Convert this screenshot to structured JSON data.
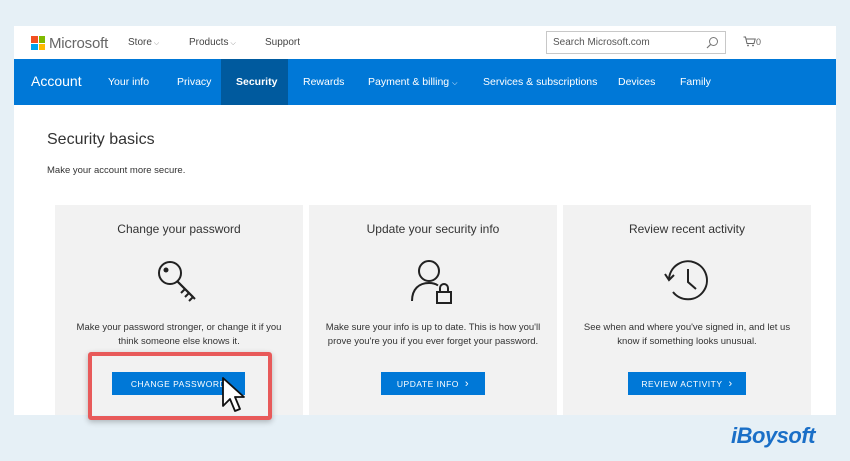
{
  "topbar": {
    "brand": "Microsoft",
    "links": [
      {
        "label": "Store",
        "has_dropdown": true
      },
      {
        "label": "Products",
        "has_dropdown": true
      },
      {
        "label": "Support",
        "has_dropdown": false
      }
    ],
    "search_placeholder": "Search Microsoft.com",
    "cart_count": "0",
    "logo_colors": [
      "#f25022",
      "#7fba00",
      "#00a4ef",
      "#ffb900"
    ]
  },
  "nav": {
    "title": "Account",
    "items": [
      {
        "label": "Your info"
      },
      {
        "label": "Privacy"
      },
      {
        "label": "Security",
        "active": true
      },
      {
        "label": "Rewards"
      },
      {
        "label": "Payment & billing",
        "has_dropdown": true
      },
      {
        "label": "Services & subscriptions"
      },
      {
        "label": "Devices"
      },
      {
        "label": "Family"
      }
    ],
    "background": "#0078d7",
    "active_background": "#005a9e"
  },
  "main": {
    "title": "Security basics",
    "subtitle": "Make your account more secure.",
    "cards": [
      {
        "title": "Change your password",
        "icon": "key-icon",
        "description": "Make your password stronger, or change it if you think someone else knows it.",
        "button": "CHANGE PASSWORD"
      },
      {
        "title": "Update your security info",
        "icon": "user-lock-icon",
        "description": "Make sure your info is up to date. This is how you'll prove you're you if you ever forget your password.",
        "button": "UPDATE INFO"
      },
      {
        "title": "Review recent activity",
        "icon": "history-clock-icon",
        "description": "See when and where you've signed in, and let us know if something looks unusual.",
        "button": "REVIEW ACTIVITY"
      }
    ],
    "button_color": "#0078d7",
    "highlight_color": "#e85a5a"
  },
  "watermark": "iBoysoft"
}
